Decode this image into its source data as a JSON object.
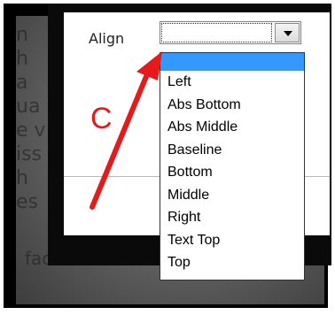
{
  "background_text": [
    "n",
    "h",
    "a",
    "ua",
    "e v",
    "iss",
    "h",
    "es"
  ],
  "background_bottom_line": "facilisis at interdum nec libero at se",
  "dialog": {
    "align_label": "Align",
    "align_value": "",
    "options": [
      "",
      "Left",
      "Abs Bottom",
      "Abs Middle",
      "Baseline",
      "Bottom",
      "Middle",
      "Right",
      "Text Top",
      "Top"
    ]
  },
  "annotation": {
    "label": "C",
    "color": "#e51a1a"
  },
  "colors": {
    "selection": "#3399ff"
  }
}
